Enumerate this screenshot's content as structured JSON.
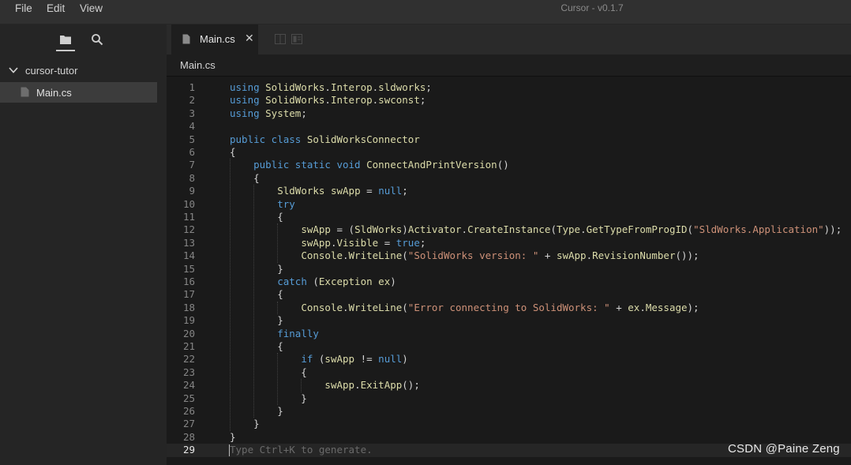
{
  "titlebar": {
    "menu": [
      "File",
      "Edit",
      "View"
    ],
    "title": "Cursor - v0.1.7"
  },
  "sidebar": {
    "tabs": [
      {
        "icon": "folder-icon",
        "active": true
      },
      {
        "icon": "search-icon",
        "active": false
      }
    ],
    "folder": {
      "name": "cursor-tutor",
      "expanded": true
    },
    "files": [
      {
        "name": "Main.cs",
        "selected": true
      }
    ]
  },
  "tabs": [
    {
      "label": "Main.cs",
      "close": "✕",
      "active": true
    }
  ],
  "breadcrumb": "Main.cs",
  "editor": {
    "current_line": 29,
    "placeholder": "Type Ctrl+K to generate.",
    "lines": [
      [
        [
          "kw",
          "using "
        ],
        [
          "ty",
          "SolidWorks"
        ],
        [
          "pl",
          "."
        ],
        [
          "ty",
          "Interop"
        ],
        [
          "pl",
          "."
        ],
        [
          "ty",
          "sldworks"
        ],
        [
          "pl",
          ";"
        ]
      ],
      [
        [
          "kw",
          "using "
        ],
        [
          "ty",
          "SolidWorks"
        ],
        [
          "pl",
          "."
        ],
        [
          "ty",
          "Interop"
        ],
        [
          "pl",
          "."
        ],
        [
          "ty",
          "swconst"
        ],
        [
          "pl",
          ";"
        ]
      ],
      [
        [
          "kw",
          "using "
        ],
        [
          "ty",
          "System"
        ],
        [
          "pl",
          ";"
        ]
      ],
      [],
      [
        [
          "kw",
          "public class "
        ],
        [
          "ty",
          "SolidWorksConnector"
        ]
      ],
      [
        [
          "pl",
          "{"
        ]
      ],
      [
        [
          "pl",
          "    "
        ],
        [
          "kw",
          "public static void "
        ],
        [
          "fn",
          "ConnectAndPrintVersion"
        ],
        [
          "pl",
          "()"
        ]
      ],
      [
        [
          "pl",
          "    {"
        ]
      ],
      [
        [
          "pl",
          "        "
        ],
        [
          "ty",
          "SldWorks"
        ],
        [
          "pl",
          " "
        ],
        [
          "ty",
          "swApp"
        ],
        [
          "pl",
          " = "
        ],
        [
          "kw",
          "null"
        ],
        [
          "pl",
          ";"
        ]
      ],
      [
        [
          "pl",
          "        "
        ],
        [
          "kw",
          "try"
        ]
      ],
      [
        [
          "pl",
          "        {"
        ]
      ],
      [
        [
          "pl",
          "            "
        ],
        [
          "ty",
          "swApp"
        ],
        [
          "pl",
          " = ("
        ],
        [
          "ty",
          "SldWorks"
        ],
        [
          "pl",
          ")"
        ],
        [
          "ty",
          "Activator"
        ],
        [
          "pl",
          "."
        ],
        [
          "fn",
          "CreateInstance"
        ],
        [
          "pl",
          "("
        ],
        [
          "ty",
          "Type"
        ],
        [
          "pl",
          "."
        ],
        [
          "fn",
          "GetTypeFromProgID"
        ],
        [
          "pl",
          "("
        ],
        [
          "str",
          "\"SldWorks.Application\""
        ],
        [
          "pl",
          "));"
        ]
      ],
      [
        [
          "pl",
          "            "
        ],
        [
          "ty",
          "swApp"
        ],
        [
          "pl",
          "."
        ],
        [
          "ty",
          "Visible"
        ],
        [
          "pl",
          " = "
        ],
        [
          "kw",
          "true"
        ],
        [
          "pl",
          ";"
        ]
      ],
      [
        [
          "pl",
          "            "
        ],
        [
          "ty",
          "Console"
        ],
        [
          "pl",
          "."
        ],
        [
          "fn",
          "WriteLine"
        ],
        [
          "pl",
          "("
        ],
        [
          "str",
          "\"SolidWorks version: \""
        ],
        [
          "pl",
          " + "
        ],
        [
          "ty",
          "swApp"
        ],
        [
          "pl",
          "."
        ],
        [
          "fn",
          "RevisionNumber"
        ],
        [
          "pl",
          "());"
        ]
      ],
      [
        [
          "pl",
          "        }"
        ]
      ],
      [
        [
          "pl",
          "        "
        ],
        [
          "kw",
          "catch "
        ],
        [
          "pl",
          "("
        ],
        [
          "ty",
          "Exception"
        ],
        [
          "pl",
          " "
        ],
        [
          "ty",
          "ex"
        ],
        [
          "pl",
          ")"
        ]
      ],
      [
        [
          "pl",
          "        {"
        ]
      ],
      [
        [
          "pl",
          "            "
        ],
        [
          "ty",
          "Console"
        ],
        [
          "pl",
          "."
        ],
        [
          "fn",
          "WriteLine"
        ],
        [
          "pl",
          "("
        ],
        [
          "str",
          "\"Error connecting to SolidWorks: \""
        ],
        [
          "pl",
          " + "
        ],
        [
          "ty",
          "ex"
        ],
        [
          "pl",
          "."
        ],
        [
          "ty",
          "Message"
        ],
        [
          "pl",
          ");"
        ]
      ],
      [
        [
          "pl",
          "        }"
        ]
      ],
      [
        [
          "pl",
          "        "
        ],
        [
          "kw",
          "finally"
        ]
      ],
      [
        [
          "pl",
          "        {"
        ]
      ],
      [
        [
          "pl",
          "            "
        ],
        [
          "kw",
          "if "
        ],
        [
          "pl",
          "("
        ],
        [
          "ty",
          "swApp"
        ],
        [
          "pl",
          " != "
        ],
        [
          "kw",
          "null"
        ],
        [
          "pl",
          ")"
        ]
      ],
      [
        [
          "pl",
          "            {"
        ]
      ],
      [
        [
          "pl",
          "                "
        ],
        [
          "ty",
          "swApp"
        ],
        [
          "pl",
          "."
        ],
        [
          "fn",
          "ExitApp"
        ],
        [
          "pl",
          "();"
        ]
      ],
      [
        [
          "pl",
          "            }"
        ]
      ],
      [
        [
          "pl",
          "        }"
        ]
      ],
      [
        [
          "pl",
          "    }"
        ]
      ],
      [
        [
          "pl",
          "}"
        ]
      ],
      []
    ]
  },
  "watermark": "CSDN @Paine Zeng"
}
